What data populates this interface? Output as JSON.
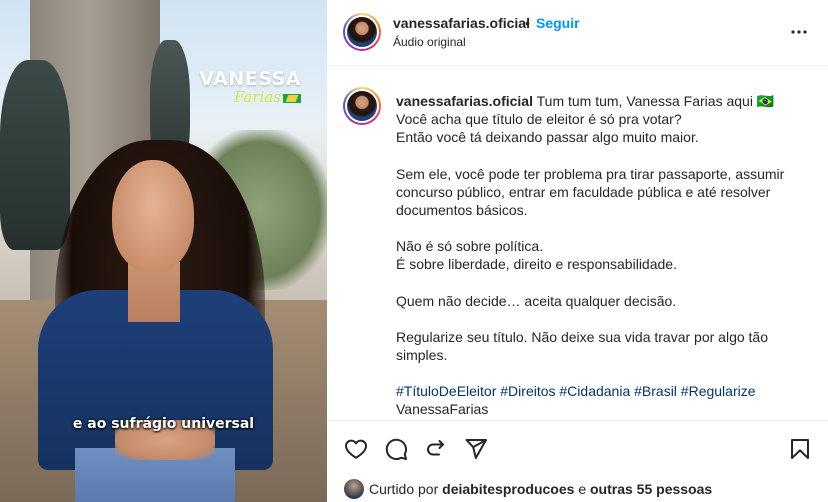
{
  "media": {
    "brand_name": "VANESSA",
    "brand_sub": "Farias",
    "caption": "e ao sufrágio universal"
  },
  "header": {
    "username": "vanessafarias.oficial",
    "separator": "•",
    "follow_label": "Seguir",
    "audio_label": "Áudio original"
  },
  "post": {
    "username": "vanessafarias.oficial",
    "lines": [
      "Tum tum tum, Vanessa Farias aqui 🇧🇷",
      "Você acha que título de eleitor é só pra votar?",
      "Então você tá deixando passar algo muito maior.",
      "Sem ele, você pode ter problema pra tirar passaporte, assumir concurso público, entrar em faculdade pública e até resolver documentos básicos.",
      "Não é só sobre política.",
      "É sobre liberdade, direito e responsabilidade.",
      "Quem não decide… aceita qualquer decisão.",
      "Regularize seu título. Não deixe sua vida travar por algo tão simples.",
      "#TítuloDeEleitor #Direitos #Cidadania #Brasil #Regularize",
      "VanessaFarias"
    ]
  },
  "likes": {
    "prefix": "Curtido por",
    "user": "deiabitesproducoes",
    "middle": "e",
    "others": "outras 55 pessoas"
  },
  "icons": {
    "like": "heart-icon",
    "comment": "comment-icon",
    "share": "repost-icon",
    "send": "send-icon",
    "save": "bookmark-icon",
    "more": "more-options-icon"
  },
  "colors": {
    "link_blue": "#0095f6",
    "hashtag_blue": "#00376b",
    "text": "#262626"
  }
}
